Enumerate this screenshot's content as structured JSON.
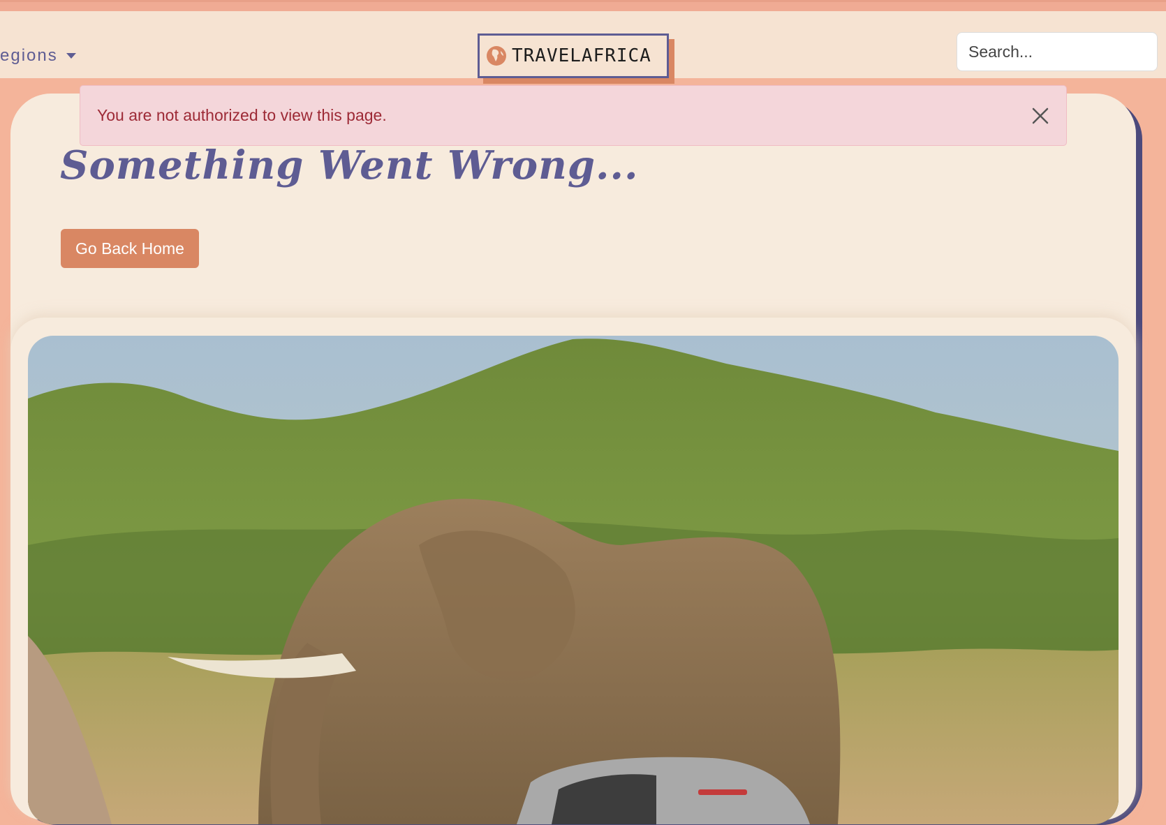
{
  "navbar": {
    "dropdown_label": "egions",
    "brand_text": "TRAVELAFRICA",
    "search_placeholder": "Search..."
  },
  "alert": {
    "message": "You are not authorized to view this page."
  },
  "main": {
    "headline": "Something Went Wrong...",
    "home_button_label": "Go Back Home"
  },
  "colors": {
    "page_bg": "#f4b49a",
    "navbar_bg": "#f6e3d2",
    "card_bg": "#f7ebdd",
    "accent_orange": "#d98763",
    "accent_purple": "#5e5c93",
    "alert_bg": "#f4d6da",
    "alert_text": "#9d2a36"
  },
  "icons": {
    "brand": "globe-africa-icon",
    "caret": "chevron-down-icon",
    "close": "close-icon"
  }
}
